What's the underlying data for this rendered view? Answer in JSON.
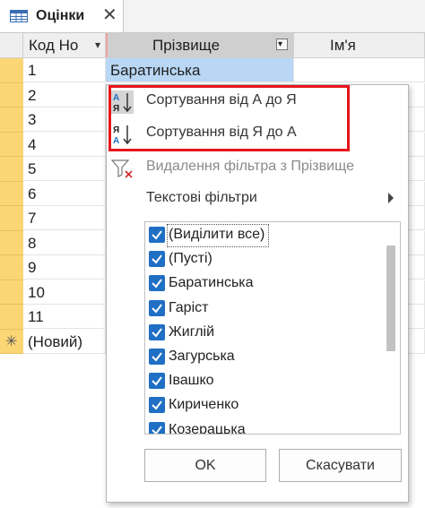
{
  "tab": {
    "title": "Оцінки",
    "close": "✕",
    "icon": "table-icon"
  },
  "columns": [
    {
      "label": "Код Но",
      "arrow": "▾"
    },
    {
      "label": "Прізвище",
      "arrow": "▾"
    },
    {
      "label": "Ім'я",
      "arrow": ""
    }
  ],
  "rows": [
    {
      "id": "1",
      "surname": "Баратинська"
    },
    {
      "id": "2",
      "surname": ""
    },
    {
      "id": "3",
      "surname": ""
    },
    {
      "id": "4",
      "surname": ""
    },
    {
      "id": "5",
      "surname": ""
    },
    {
      "id": "6",
      "surname": ""
    },
    {
      "id": "7",
      "surname": ""
    },
    {
      "id": "8",
      "surname": ""
    },
    {
      "id": "9",
      "surname": ""
    },
    {
      "id": "10",
      "surname": ""
    },
    {
      "id": "11",
      "surname": ""
    }
  ],
  "new_row": {
    "marker": "✳",
    "label": "(Новий)"
  },
  "menu": {
    "sort_asc": "Сортування від А до Я",
    "sort_desc": "Сортування від Я до А",
    "clear_filter": "Видалення фільтра з Прізвище",
    "text_filters": "Текстові фільтри",
    "ok": "OK",
    "cancel": "Скасувати"
  },
  "filter_items": [
    {
      "label": "(Виділити все)",
      "checked": true
    },
    {
      "label": "(Пусті)",
      "checked": true
    },
    {
      "label": "Баратинська",
      "checked": true
    },
    {
      "label": "Гаріст",
      "checked": true
    },
    {
      "label": "Жиглій",
      "checked": true
    },
    {
      "label": "Загурська",
      "checked": true
    },
    {
      "label": "Івашко",
      "checked": true
    },
    {
      "label": "Кириченко",
      "checked": true
    },
    {
      "label": "Козерацька",
      "checked": true
    }
  ],
  "colors": {
    "accent": "#1f6fc4",
    "row_selector": "#fbd675",
    "highlight": "#e5161b",
    "selected_cell": "#b9d7f4"
  }
}
